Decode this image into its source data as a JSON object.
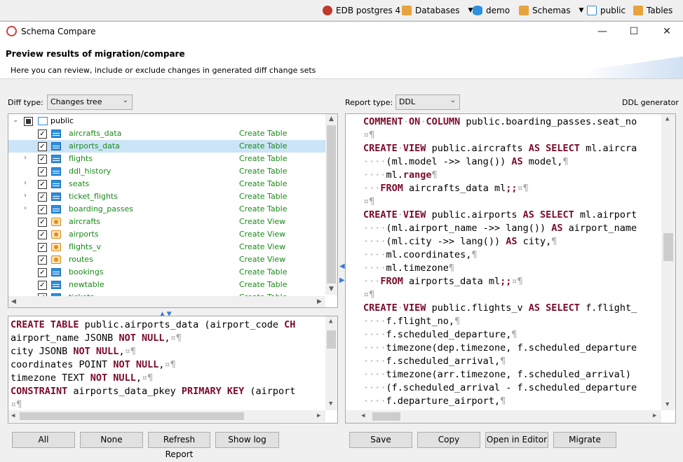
{
  "topbar": {
    "connection": "EDB postgres 4",
    "databases": "Databases",
    "db": "demo",
    "schemas": "Schemas",
    "schema": "public",
    "tables": "Tables"
  },
  "window": {
    "title": "Schema Compare",
    "minimize": "—",
    "maximize": "☐",
    "close": "✕"
  },
  "header": {
    "title": "Preview results of migration/compare",
    "subtitle": "Here you can review, include or exclude changes in generated diff change sets"
  },
  "left": {
    "diff_type_label": "Diff type:",
    "diff_type_value": "Changes tree",
    "root": "public",
    "items": [
      {
        "name": "aircrafts_data",
        "action": "Create Table",
        "kind": "table",
        "expand": false
      },
      {
        "name": "airports_data",
        "action": "Create Table",
        "kind": "table",
        "expand": false
      },
      {
        "name": "flights",
        "action": "Create Table",
        "kind": "table",
        "expand": true
      },
      {
        "name": "ddl_history",
        "action": "Create Table",
        "kind": "table",
        "expand": false
      },
      {
        "name": "seats",
        "action": "Create Table",
        "kind": "table",
        "expand": true
      },
      {
        "name": "ticket_flights",
        "action": "Create Table",
        "kind": "table",
        "expand": true
      },
      {
        "name": "boarding_passes",
        "action": "Create Table",
        "kind": "table",
        "expand": true
      },
      {
        "name": "aircrafts",
        "action": "Create View",
        "kind": "view",
        "expand": false
      },
      {
        "name": "airports",
        "action": "Create View",
        "kind": "view",
        "expand": false
      },
      {
        "name": "flights_v",
        "action": "Create View",
        "kind": "view",
        "expand": false
      },
      {
        "name": "routes",
        "action": "Create View",
        "kind": "view",
        "expand": false
      },
      {
        "name": "bookings",
        "action": "Create Table",
        "kind": "table",
        "expand": false
      },
      {
        "name": "newtable",
        "action": "Create Table",
        "kind": "table",
        "expand": false
      },
      {
        "name": "tickets",
        "action": "Create Table",
        "kind": "table",
        "expand": false
      }
    ],
    "ddl_lines": [
      [
        {
          "t": "CREATE TABLE",
          "k": 1
        },
        {
          "t": " public.airports_data (airport_code "
        },
        {
          "t": "CH",
          "k": 1
        }
      ],
      [
        {
          "t": "airport_name JSONB "
        },
        {
          "t": "NOT NULL",
          "k": 1
        },
        {
          "t": ","
        },
        {
          "t": "¤¶",
          "d": 1
        }
      ],
      [
        {
          "t": "city JSONB "
        },
        {
          "t": "NOT NULL",
          "k": 1
        },
        {
          "t": ","
        },
        {
          "t": "¤¶",
          "d": 1
        }
      ],
      [
        {
          "t": "coordinates POINT "
        },
        {
          "t": "NOT NULL",
          "k": 1
        },
        {
          "t": ","
        },
        {
          "t": "¤¶",
          "d": 1
        }
      ],
      [
        {
          "t": "timezone TEXT "
        },
        {
          "t": "NOT NULL",
          "k": 1
        },
        {
          "t": ","
        },
        {
          "t": "¤¶",
          "d": 1
        }
      ],
      [
        {
          "t": "CONSTRAINT",
          "k": 1
        },
        {
          "t": " airports_data_pkey "
        },
        {
          "t": "PRIMARY KEY",
          "k": 1
        },
        {
          "t": " (airport"
        }
      ],
      [
        {
          "t": "¤¶",
          "d": 1
        }
      ]
    ],
    "buttons": {
      "all": "All",
      "none": "None",
      "refresh": "Refresh Report",
      "showlog": "Show log"
    }
  },
  "right": {
    "report_type_label": "Report type:",
    "report_type_value": "DDL",
    "ddl_generator": "DDL generator",
    "report_lines": [
      [
        {
          "t": "COMMENT",
          "k": 1
        },
        {
          "t": "·",
          "d": 1
        },
        {
          "t": "ON",
          "k": 1
        },
        {
          "t": "·",
          "d": 1
        },
        {
          "t": "COLUMN",
          "k": 1
        },
        {
          "t": " public.boarding_passes.seat_no"
        }
      ],
      [
        {
          "t": "¤¶",
          "d": 1
        }
      ],
      [
        {
          "t": "CREATE",
          "k": 1
        },
        {
          "t": "·",
          "d": 1
        },
        {
          "t": "VIEW",
          "k": 1
        },
        {
          "t": " public.aircrafts "
        },
        {
          "t": "AS",
          "k": 1
        },
        {
          "t": " "
        },
        {
          "t": "SELECT",
          "k": 1
        },
        {
          "t": " ml.aircra"
        }
      ],
      [
        {
          "t": "····",
          "d": 1
        },
        {
          "t": "(ml.model ->> lang()) "
        },
        {
          "t": "AS",
          "k": 1
        },
        {
          "t": " model,"
        },
        {
          "t": "¶",
          "d": 1
        }
      ],
      [
        {
          "t": "····",
          "d": 1
        },
        {
          "t": "ml."
        },
        {
          "t": "range",
          "k": 1
        },
        {
          "t": "¶",
          "d": 1
        }
      ],
      [
        {
          "t": "···",
          "d": 1
        },
        {
          "t": "FROM",
          "k": 1
        },
        {
          "t": " aircrafts_data ml"
        },
        {
          "t": ";;",
          "k": 1
        },
        {
          "t": "¤¶",
          "d": 1
        }
      ],
      [
        {
          "t": "¤¶",
          "d": 1
        }
      ],
      [
        {
          "t": "CREATE",
          "k": 1
        },
        {
          "t": "·",
          "d": 1
        },
        {
          "t": "VIEW",
          "k": 1
        },
        {
          "t": " public.airports "
        },
        {
          "t": "AS",
          "k": 1
        },
        {
          "t": " "
        },
        {
          "t": "SELECT",
          "k": 1
        },
        {
          "t": " ml.airport"
        }
      ],
      [
        {
          "t": "····",
          "d": 1
        },
        {
          "t": "(ml.airport_name ->> lang()) "
        },
        {
          "t": "AS",
          "k": 1
        },
        {
          "t": " airport_name"
        }
      ],
      [
        {
          "t": "····",
          "d": 1
        },
        {
          "t": "(ml.city ->> lang()) "
        },
        {
          "t": "AS",
          "k": 1
        },
        {
          "t": " city,"
        },
        {
          "t": "¶",
          "d": 1
        }
      ],
      [
        {
          "t": "····",
          "d": 1
        },
        {
          "t": "ml.coordinates,"
        },
        {
          "t": "¶",
          "d": 1
        }
      ],
      [
        {
          "t": "····",
          "d": 1
        },
        {
          "t": "ml.timezone"
        },
        {
          "t": "¶",
          "d": 1
        }
      ],
      [
        {
          "t": "···",
          "d": 1
        },
        {
          "t": "FROM",
          "k": 1
        },
        {
          "t": " airports_data ml"
        },
        {
          "t": ";;",
          "k": 1
        },
        {
          "t": "¤¶",
          "d": 1
        }
      ],
      [
        {
          "t": "¤¶",
          "d": 1
        }
      ],
      [
        {
          "t": "CREATE",
          "k": 1
        },
        {
          "t": "·",
          "d": 1
        },
        {
          "t": "VIEW",
          "k": 1
        },
        {
          "t": " public.flights_v "
        },
        {
          "t": "AS",
          "k": 1
        },
        {
          "t": " "
        },
        {
          "t": "SELECT",
          "k": 1
        },
        {
          "t": " f.flight_"
        }
      ],
      [
        {
          "t": "····",
          "d": 1
        },
        {
          "t": "f.flight_no,"
        },
        {
          "t": "¶",
          "d": 1
        }
      ],
      [
        {
          "t": "····",
          "d": 1
        },
        {
          "t": "f.scheduled_departure,"
        },
        {
          "t": "¶",
          "d": 1
        }
      ],
      [
        {
          "t": "····",
          "d": 1
        },
        {
          "t": "timezone(dep.timezone, f.scheduled_departure"
        }
      ],
      [
        {
          "t": "····",
          "d": 1
        },
        {
          "t": "f.scheduled_arrival,"
        },
        {
          "t": "¶",
          "d": 1
        }
      ],
      [
        {
          "t": "····",
          "d": 1
        },
        {
          "t": "timezone(arr.timezone, f.scheduled_arrival)"
        }
      ],
      [
        {
          "t": "····",
          "d": 1
        },
        {
          "t": "(f.scheduled_arrival - f.scheduled_departure"
        }
      ],
      [
        {
          "t": "····",
          "d": 1
        },
        {
          "t": "f.departure_airport,"
        },
        {
          "t": "¶",
          "d": 1
        }
      ]
    ],
    "buttons": {
      "save": "Save",
      "copy": "Copy",
      "open": "Open in Editor",
      "migrate": "Migrate"
    }
  }
}
